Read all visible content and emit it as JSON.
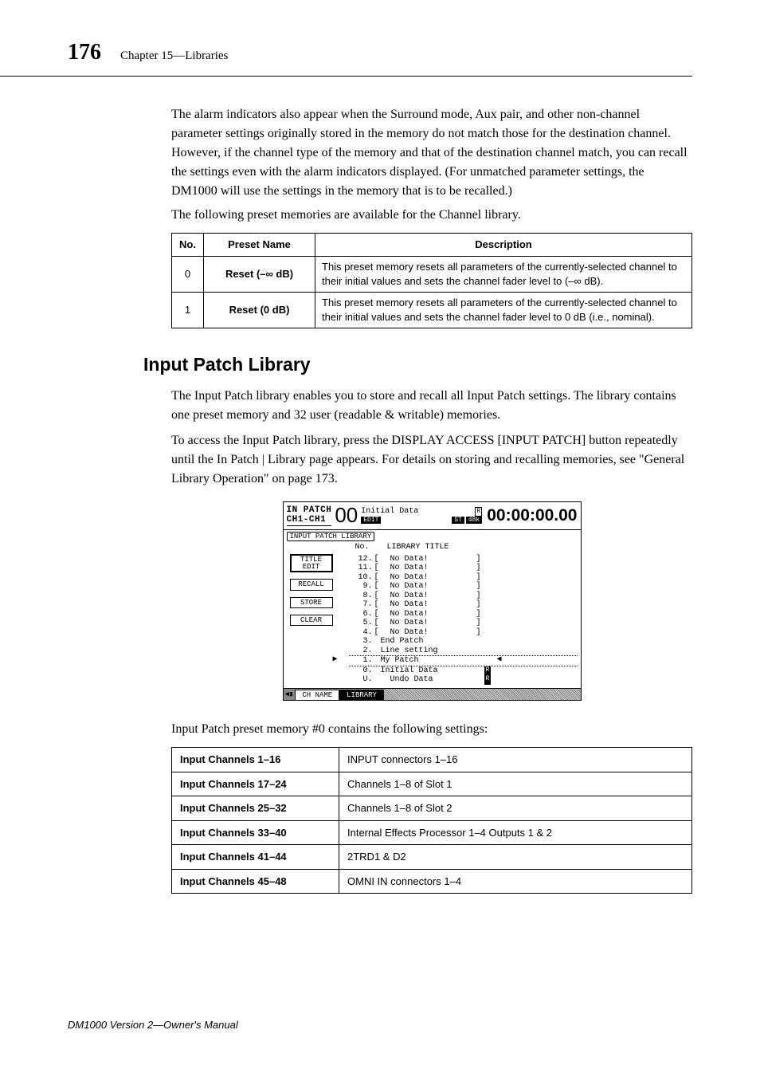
{
  "header": {
    "page_number": "176",
    "chapter": "Chapter 15—Libraries"
  },
  "para1": "The alarm indicators also appear when the Surround mode, Aux pair, and other non-channel parameter settings originally stored in the memory do not match those for the destination channel. However, if the channel type of the memory and that of the destination channel match, you can recall the settings even with the alarm indicators displayed. (For unmatched parameter settings, the DM1000 will use the settings in the memory that is to be recalled.)",
  "para2": "The following preset memories are available for the Channel library.",
  "preset_table": {
    "headers": {
      "no": "No.",
      "name": "Preset Name",
      "desc": "Description"
    },
    "rows": [
      {
        "no": "0",
        "name": "Reset (–∞ dB)",
        "desc": "This preset memory resets all parameters of the currently-selected channel to their initial values and sets the channel fader level to (–∞ dB)."
      },
      {
        "no": "1",
        "name": "Reset (0 dB)",
        "desc": "This preset memory resets all parameters of the currently-selected channel to their initial values and sets the channel fader level to 0 dB (i.e., nominal)."
      }
    ]
  },
  "section": {
    "heading": "Input Patch Library",
    "p1": "The Input Patch library enables you to store and recall all Input Patch settings. The library contains one preset memory and 32 user (readable & writable) memories.",
    "p2": "To access the Input Patch library, press the DISPLAY ACCESS [INPUT PATCH] button repeatedly until the In Patch | Library page appears. For details on storing and recalling memories, see \"General Library Operation\" on page 173."
  },
  "screenshot": {
    "top_label1": "IN PATCH",
    "top_label2": "CH1-CH1",
    "meter": "00",
    "status_text": "Initial Data",
    "badge_edit": "EDIT",
    "badge_st": "ST",
    "badge_48k": "48k",
    "badge_r": "R",
    "timecode": "00:00:00.00",
    "sublabel": "INPUT PATCH LIBRARY",
    "col_no": "No.",
    "col_title": "LIBRARY TITLE",
    "buttons": {
      "title_edit1": "TITLE",
      "title_edit2": "EDIT",
      "recall": "RECALL",
      "store": "STORE",
      "clear": "CLEAR"
    },
    "list": [
      {
        "n": "12.",
        "b1": "[",
        "t": "  No Data!",
        "b2": "]"
      },
      {
        "n": "11.",
        "b1": "[",
        "t": "  No Data!",
        "b2": "]"
      },
      {
        "n": "10.",
        "b1": "[",
        "t": "  No Data!",
        "b2": "]"
      },
      {
        "n": "9.",
        "b1": "[",
        "t": "  No Data!",
        "b2": "]"
      },
      {
        "n": "8.",
        "b1": "[",
        "t": "  No Data!",
        "b2": "]"
      },
      {
        "n": "7.",
        "b1": "[",
        "t": "  No Data!",
        "b2": "]"
      },
      {
        "n": "6.",
        "b1": "[",
        "t": "  No Data!",
        "b2": "]"
      },
      {
        "n": "5.",
        "b1": "[",
        "t": "  No Data!",
        "b2": "]"
      },
      {
        "n": "4.",
        "b1": "[",
        "t": "  No Data!",
        "b2": "]"
      },
      {
        "n": "3.",
        "b1": "",
        "t": "End Patch",
        "b2": ""
      },
      {
        "n": "2.",
        "b1": "",
        "t": "Line setting",
        "b2": ""
      }
    ],
    "selected": {
      "n": "1.",
      "t": "My Patch"
    },
    "after": [
      {
        "n": "0.",
        "t": "Initial Data",
        "r": "R"
      },
      {
        "n": "U.",
        "t": "  Undo Data",
        "r": "R"
      }
    ],
    "tabs": {
      "t1": "CH NAME",
      "t2": "LIBRARY"
    }
  },
  "settings_lead": "Input Patch preset memory #0 contains the following settings:",
  "settings_table": [
    {
      "label": "Input Channels 1–16",
      "value": "INPUT connectors 1–16"
    },
    {
      "label": "Input Channels 17–24",
      "value": "Channels 1–8 of Slot 1"
    },
    {
      "label": "Input Channels 25–32",
      "value": "Channels 1–8 of Slot 2"
    },
    {
      "label": "Input Channels 33–40",
      "value": "Internal Effects Processor 1–4 Outputs 1 & 2"
    },
    {
      "label": "Input Channels 41–44",
      "value": "2TRD1 & D2"
    },
    {
      "label": "Input Channels 45–48",
      "value": "OMNI IN connectors 1–4"
    }
  ],
  "footer": "DM1000 Version 2—Owner's Manual"
}
